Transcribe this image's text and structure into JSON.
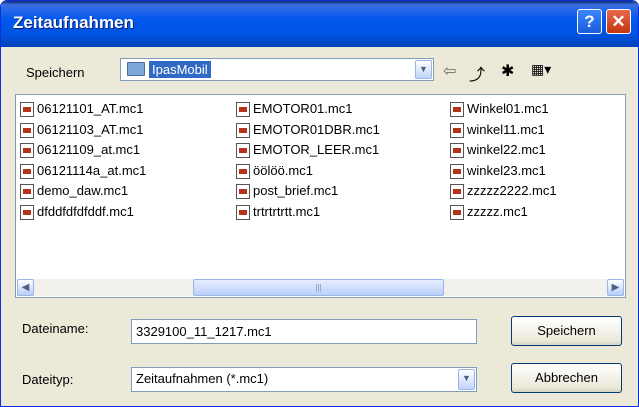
{
  "window": {
    "title": "Zeitaufnahmen",
    "help_glyph": "?",
    "close_glyph": "✕"
  },
  "savein": {
    "label": "Speichern",
    "folder": "IpasMobil"
  },
  "toolbar": {
    "back_glyph": "⇦",
    "up_glyph": "⤴",
    "newfolder_glyph": "✱",
    "view_glyph": "▦▾"
  },
  "files": [
    "06121101_AT.mc1",
    "06121103_AT.mc1",
    "06121109_at.mc1",
    "06121114a_at.mc1",
    "demo_daw.mc1",
    "dfddfdfdfddf.mc1",
    "EMOTOR01.mc1",
    "EMOTOR01DBR.mc1",
    "EMOTOR_LEER.mc1",
    "öölöö.mc1",
    "post_brief.mc1",
    "trtrtrtrtt.mc1",
    "Winkel01.mc1",
    "winkel11.mc1",
    "winkel22.mc1",
    "winkel23.mc1",
    "zzzzz2222.mc1",
    "zzzzz.mc1"
  ],
  "scroll": {
    "left_glyph": "◀",
    "right_glyph": "▶",
    "grip": "|||"
  },
  "filename": {
    "label": "Dateiname:",
    "value": "3329100_11_1217.mc1"
  },
  "filetype": {
    "label": "Dateityp:",
    "value": "Zeitaufnahmen (*.mc1)"
  },
  "buttons": {
    "save": "Speichern",
    "cancel": "Abbrechen"
  },
  "dropdown_glyph": "▼"
}
